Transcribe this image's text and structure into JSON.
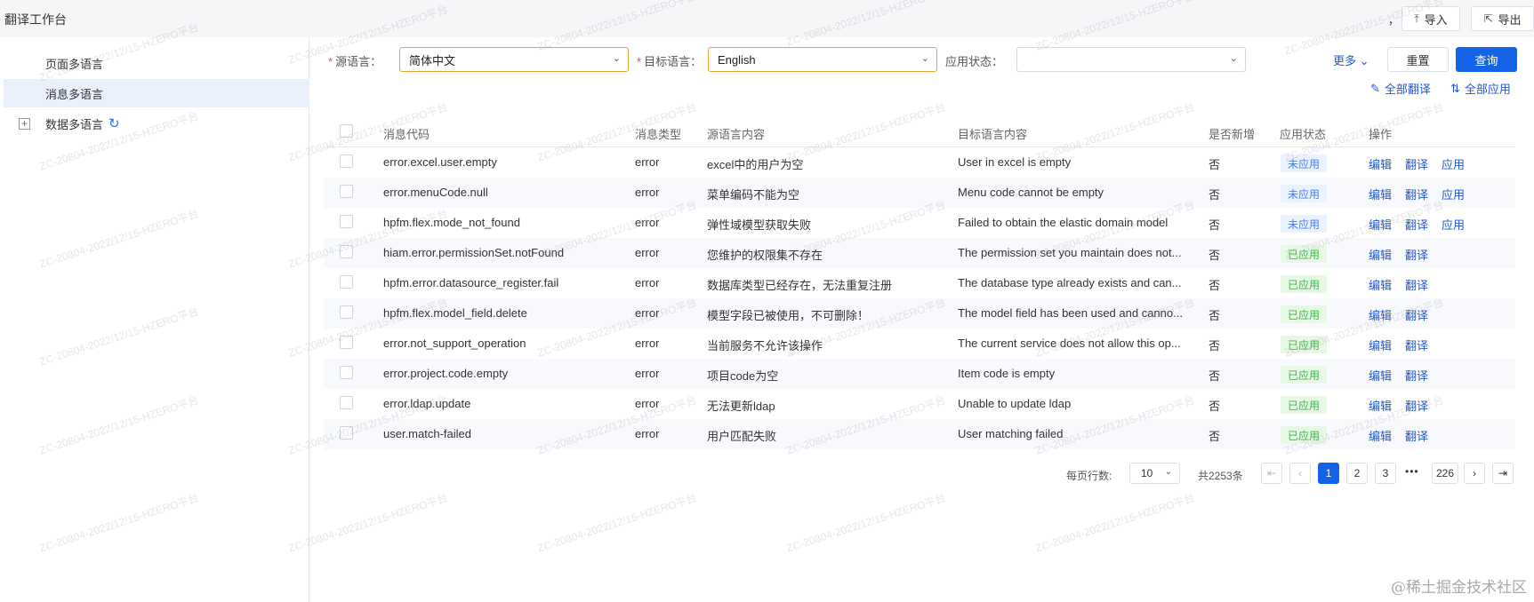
{
  "app": {
    "title": "翻译工作台",
    "top_comma": "，"
  },
  "top_actions": {
    "import_label": "导入",
    "export_label": "导出"
  },
  "sidebar": {
    "items": [
      {
        "label": "页面多语言",
        "active": false
      },
      {
        "label": "消息多语言",
        "active": true
      },
      {
        "label": "数据多语言",
        "active": false,
        "expander": "+"
      }
    ]
  },
  "filters": {
    "source_label": "源语言：",
    "source_value": "简体中文",
    "target_label": "目标语言：",
    "target_value": "English",
    "status_label": "应用状态：",
    "status_value": "",
    "required_mark": "*",
    "more_label": "更多",
    "reset_label": "重置",
    "query_label": "查询"
  },
  "toolbar": {
    "translate_all": "全部翻译",
    "apply_all": "全部应用"
  },
  "table": {
    "headers": {
      "code": "消息代码",
      "type": "消息类型",
      "source": "源语言内容",
      "target": "目标语言内容",
      "is_new": "是否新增",
      "status": "应用状态",
      "ops": "操作"
    },
    "actions": {
      "edit": "编辑",
      "translate": "翻译",
      "apply": "应用"
    },
    "rows": [
      {
        "code": "error.excel.user.empty",
        "type": "error",
        "source": "excel中的用户为空",
        "target": "User in excel is empty",
        "is_new": "否",
        "status": "未应用",
        "applied": false
      },
      {
        "code": "error.menuCode.null",
        "type": "error",
        "source": "菜单编码不能为空",
        "target": "Menu code cannot be empty",
        "is_new": "否",
        "status": "未应用",
        "applied": false
      },
      {
        "code": "hpfm.flex.mode_not_found",
        "type": "error",
        "source": "弹性域模型获取失败",
        "target": "Failed to obtain the elastic domain model",
        "is_new": "否",
        "status": "未应用",
        "applied": false
      },
      {
        "code": "hiam.error.permissionSet.notFound",
        "type": "error",
        "source": "您维护的权限集不存在",
        "target": "The permission set you maintain does not...",
        "is_new": "否",
        "status": "已应用",
        "applied": true
      },
      {
        "code": "hpfm.error.datasource_register.fail",
        "type": "error",
        "source": "数据库类型已经存在，无法重复注册",
        "target": "The database type already exists and can...",
        "is_new": "否",
        "status": "已应用",
        "applied": true
      },
      {
        "code": "hpfm.flex.model_field.delete",
        "type": "error",
        "source": "模型字段已被使用，不可删除！",
        "target": "The model field has been used and canno...",
        "is_new": "否",
        "status": "已应用",
        "applied": true
      },
      {
        "code": "error.not_support_operation",
        "type": "error",
        "source": "当前服务不允许该操作",
        "target": "The current service does not allow this op...",
        "is_new": "否",
        "status": "已应用",
        "applied": true
      },
      {
        "code": "error.project.code.empty",
        "type": "error",
        "source": "项目code为空",
        "target": "Item code is empty",
        "is_new": "否",
        "status": "已应用",
        "applied": true
      },
      {
        "code": "error.ldap.update",
        "type": "error",
        "source": "无法更新ldap",
        "target": "Unable to update ldap",
        "is_new": "否",
        "status": "已应用",
        "applied": true
      },
      {
        "code": "user.match-failed",
        "type": "error",
        "source": "用户匹配失败",
        "target": "User matching failed",
        "is_new": "否",
        "status": "已应用",
        "applied": true
      }
    ]
  },
  "pagination": {
    "page_size_label": "每页行数:",
    "page_size": "10",
    "total": "共2253条",
    "pages": [
      "1",
      "2",
      "3"
    ],
    "ellipsis": "•••",
    "last_page": "226",
    "current_page": "1"
  },
  "watermark": {
    "text": "ZC-20804-2022/12/15-HZERO平台",
    "corner": "@稀土掘金技术社区"
  },
  "colors": {
    "primary": "#1463e6",
    "link": "#2157d1",
    "applied": "#3fb34f",
    "not_applied": "#4a7de0",
    "required": "#e34d59"
  }
}
